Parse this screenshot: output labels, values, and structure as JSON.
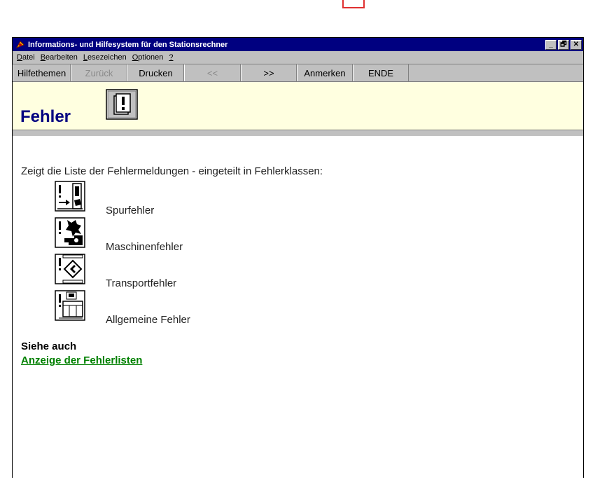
{
  "window": {
    "title": "Informations- und Hilfesystem für den Stationsrechner",
    "controls": [
      "_",
      "🗗",
      "✕"
    ]
  },
  "menu": [
    {
      "accel": "D",
      "rest": "atei"
    },
    {
      "accel": "B",
      "rest": "earbeiten"
    },
    {
      "accel": "L",
      "rest": "esezeichen"
    },
    {
      "accel": "O",
      "rest": "ptionen"
    },
    {
      "accel": "?",
      "rest": ""
    }
  ],
  "toolbar": {
    "buttons": [
      {
        "label": "Hilfethemen",
        "enabled": true
      },
      {
        "label": "Zurück",
        "enabled": false
      },
      {
        "label": "Drucken",
        "enabled": true
      },
      {
        "label": "<<",
        "enabled": false
      },
      {
        "label": ">>",
        "enabled": true
      },
      {
        "label": "Anmerken",
        "enabled": true
      },
      {
        "label": "ENDE",
        "enabled": true
      }
    ]
  },
  "header": {
    "title": "Fehler",
    "icon": "error-list-icon"
  },
  "content": {
    "intro": "Zeigt die Liste der Fehlermeldungen - eingeteilt in Fehlerklassen:",
    "error_classes": [
      {
        "label": "Spurfehler",
        "icon": "track-error-icon"
      },
      {
        "label": "Maschinenfehler",
        "icon": "machine-error-icon"
      },
      {
        "label": "Transportfehler",
        "icon": "transport-error-icon"
      },
      {
        "label": "Allgemeine Fehler",
        "icon": "general-error-icon"
      }
    ],
    "see_also": "Siehe auch",
    "link": "Anzeige der Fehlerlisten"
  },
  "colors": {
    "titlebar": "#000080",
    "header_band": "#ffffe0",
    "title_text": "#000080",
    "link": "#008000"
  }
}
